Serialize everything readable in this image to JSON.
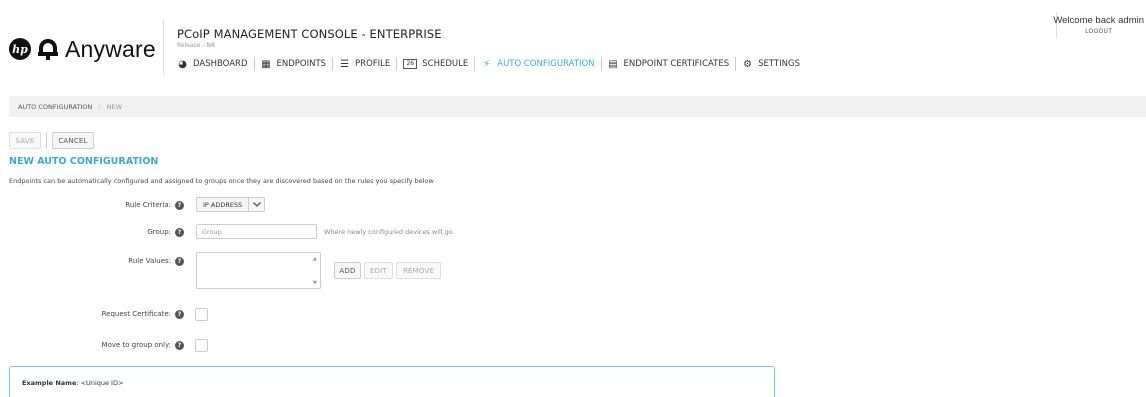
{
  "brand": {
    "hp_logo": "hp",
    "product_name": "Anyware"
  },
  "header": {
    "title": "PCoIP MANAGEMENT CONSOLE - ENTERPRISE",
    "release": "Release - NA",
    "welcome": "Welcome back admin",
    "logout": "LOGOUT"
  },
  "nav": {
    "items": [
      {
        "label": "DASHBOARD",
        "icon": "dashboard-icon",
        "glyph": "◕"
      },
      {
        "label": "ENDPOINTS",
        "icon": "endpoints-icon",
        "glyph": "▦"
      },
      {
        "label": "PROFILE",
        "icon": "profile-icon",
        "glyph": "☰"
      },
      {
        "label": "SCHEDULE",
        "icon": "schedule-icon",
        "glyph": "26"
      },
      {
        "label": "AUTO CONFIGURATION",
        "icon": "bolt-icon",
        "glyph": "⚡",
        "active": true
      },
      {
        "label": "ENDPOINT CERTIFICATES",
        "icon": "certificate-icon",
        "glyph": "▤"
      },
      {
        "label": "SETTINGS",
        "icon": "gear-icon",
        "glyph": "⚙"
      }
    ],
    "accent_color": "#3aa9d6"
  },
  "breadcrumb": {
    "parent": "AUTO CONFIGURATION",
    "separator": "/",
    "current": "NEW"
  },
  "toolbar": {
    "save_label": "SAVE",
    "cancel_label": "CANCEL"
  },
  "page": {
    "title": "NEW AUTO CONFIGURATION",
    "description": "Endpoints can be automatically configured and assigned to groups once they are discovered based on the rules you specify below"
  },
  "form": {
    "rule_criteria": {
      "label": "Rule Criteria:",
      "value": "IP ADDRESS"
    },
    "group": {
      "label": "Group:",
      "placeholder": "Group",
      "hint": "Where newly configured devices will go"
    },
    "rule_values": {
      "label": "Rule Values:",
      "add_label": "ADD",
      "edit_label": "EDIT",
      "remove_label": "REMOVE"
    },
    "request_certificate": {
      "label": "Request Certificate:"
    },
    "move_to_group_only": {
      "label": "Move to group only:"
    },
    "help_glyph": "?"
  },
  "example": {
    "label": "Example Name",
    "value": ": <Unique ID>"
  }
}
